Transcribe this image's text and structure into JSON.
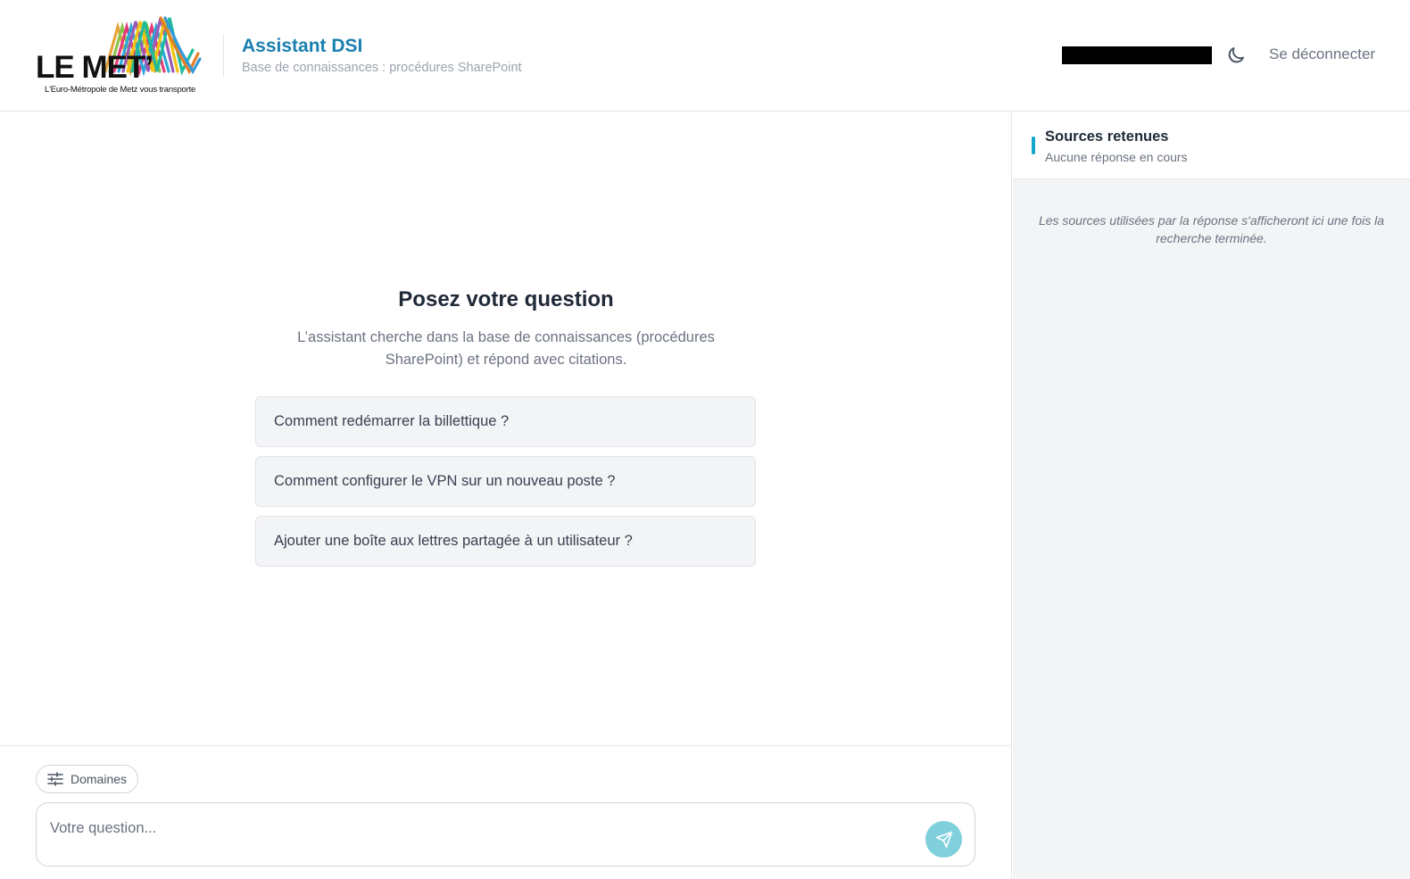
{
  "brand": {
    "logo_text": "LE MET’",
    "logo_tagline": "L'Euro-Métropole de Metz vous transporte"
  },
  "header": {
    "title": "Assistant DSI",
    "subtitle": "Base de connaissances : procédures SharePoint",
    "theme_icon": "moon-icon",
    "logout_label": "Se déconnecter"
  },
  "main": {
    "empty_title": "Posez votre question",
    "empty_description": "L’assistant cherche dans la base de connaissances (procédures SharePoint) et répond avec citations.",
    "suggestions": [
      "Comment redémarrer la billettique ?",
      "Comment configurer le VPN sur un nouveau poste ?",
      "Ajouter une boîte aux lettres partagée à un utilisateur ?"
    ]
  },
  "composer": {
    "domains_label": "Domaines",
    "domains_icon": "sliders-icon",
    "placeholder": "Votre question...",
    "send_icon": "send-icon"
  },
  "sources": {
    "title": "Sources retenues",
    "status": "Aucune réponse en cours",
    "empty_message": "Les sources utilisées par la réponse s'afficheront ici une fois la recherche terminée."
  },
  "colors": {
    "accent": "#1a7fb0",
    "send_button": "#7fd0dc",
    "sources_accent": "#11a5c9",
    "panel_bg": "#f3f4f6"
  }
}
